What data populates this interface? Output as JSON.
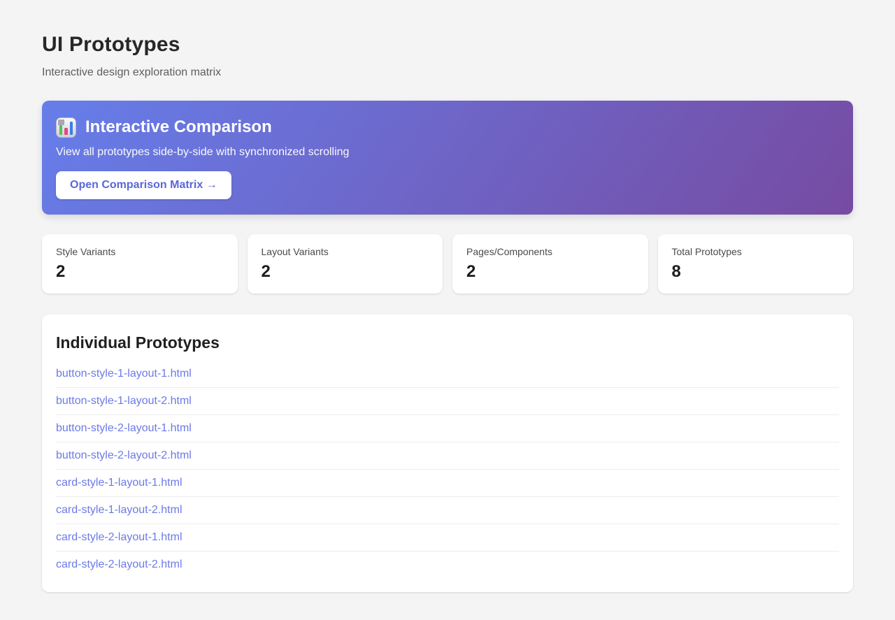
{
  "theme": {
    "background": "#f4f4f5",
    "banner_gradient_start": "#667eea",
    "banner_gradient_end": "#764ba2",
    "link_color": "#6b7ae8",
    "button_text_color": "#5a67d8"
  },
  "header": {
    "title": "UI Prototypes",
    "subtitle": "Interactive design exploration matrix"
  },
  "banner": {
    "icon": "bar-chart-icon",
    "title": "Interactive Comparison",
    "description": "View all prototypes side-by-side with synchronized scrolling",
    "button_label": "Open Comparison Matrix →"
  },
  "stats": [
    {
      "label": "Style Variants",
      "value": "2"
    },
    {
      "label": "Layout Variants",
      "value": "2"
    },
    {
      "label": "Pages/Components",
      "value": "2"
    },
    {
      "label": "Total Prototypes",
      "value": "8"
    }
  ],
  "prototypes": {
    "heading": "Individual Prototypes",
    "links": [
      "button-style-1-layout-1.html",
      "button-style-1-layout-2.html",
      "button-style-2-layout-1.html",
      "button-style-2-layout-2.html",
      "card-style-1-layout-1.html",
      "card-style-1-layout-2.html",
      "card-style-2-layout-1.html",
      "card-style-2-layout-2.html"
    ]
  }
}
